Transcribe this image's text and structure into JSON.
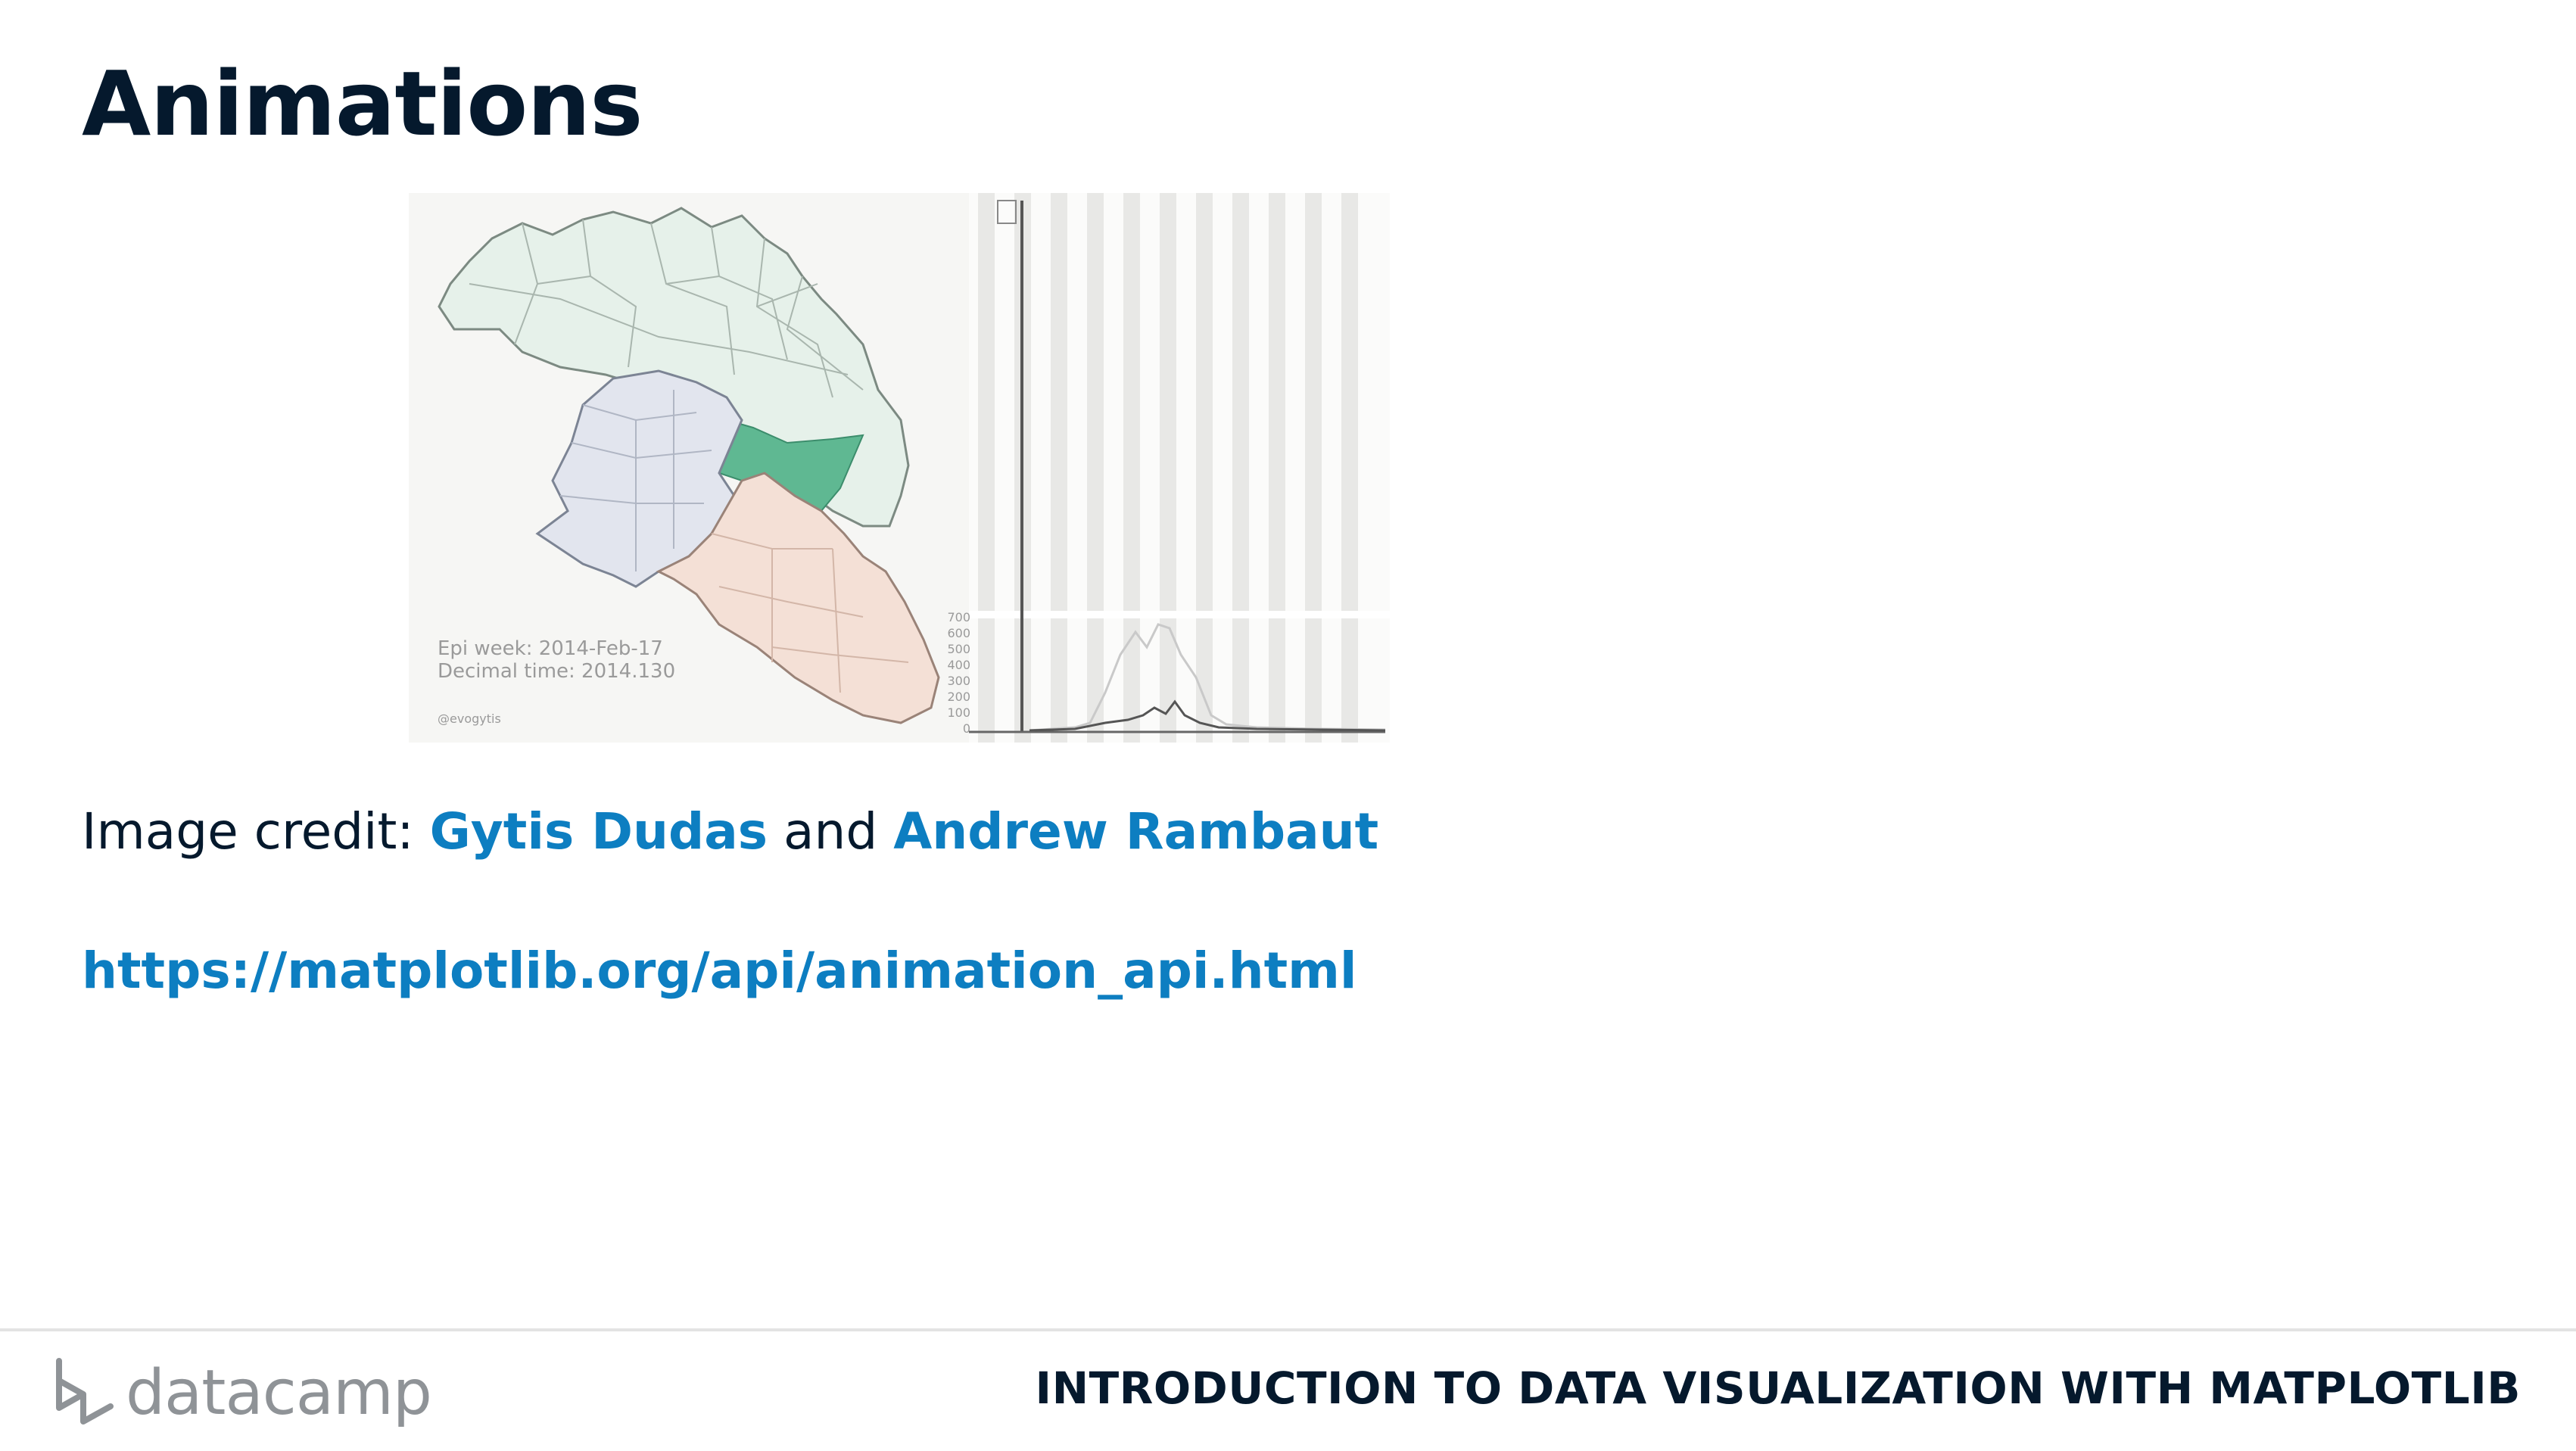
{
  "slide": {
    "title": "Animations"
  },
  "figure": {
    "epi_week": "Epi week: 2014-Feb-17",
    "decimal_time": "Decimal time: 2014.130",
    "handle": "@evogytis",
    "y_ticks": [
      "700",
      "600",
      "500",
      "400",
      "300",
      "200",
      "100",
      "0"
    ],
    "colors": {
      "guinea": "#e6f1ea",
      "sierra_leone": "#e2e5ee",
      "liberia": "#f4e0d6",
      "highlight": "#5fb892"
    }
  },
  "credit": {
    "prefix": "Image credit: ",
    "author1": "Gytis Dudas",
    "joiner": " and ",
    "author2": "Andrew Rambaut"
  },
  "link": {
    "url": "https://matplotlib.org/api/animation_api.html"
  },
  "footer": {
    "brand": "datacamp",
    "course": "INTRODUCTION TO DATA VISUALIZATION WITH MATPLOTLIB"
  }
}
